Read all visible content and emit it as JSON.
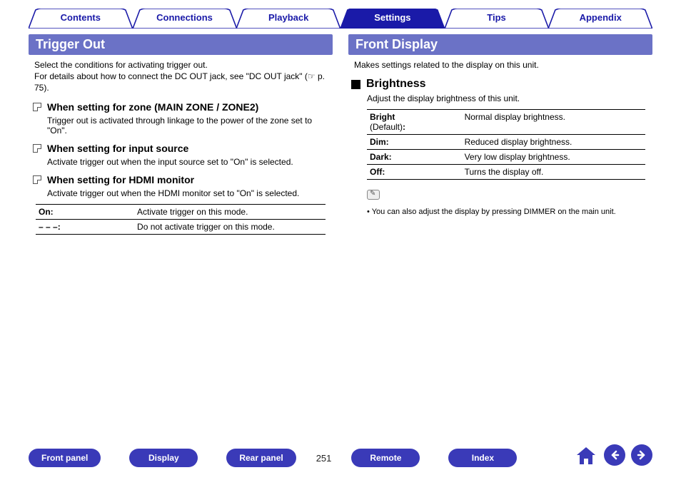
{
  "tabs": {
    "contents": "Contents",
    "connections": "Connections",
    "playback": "Playback",
    "settings": "Settings",
    "tips": "Tips",
    "appendix": "Appendix"
  },
  "left": {
    "header": "Trigger Out",
    "intro1": "Select the conditions for activating trigger out.",
    "intro2": "For details about how to connect the DC OUT jack, see \"DC OUT jack\" (☞ p. 75).",
    "s1_title": "When setting for zone (MAIN ZONE / ZONE2)",
    "s1_desc": "Trigger out is activated through linkage to the power of the zone set to \"On\".",
    "s2_title": "When setting for input source",
    "s2_desc": "Activate trigger out when the input source set to \"On\" is selected.",
    "s3_title": "When setting for HDMI monitor",
    "s3_desc": "Activate trigger out when the HDMI monitor set to \"On\" is selected.",
    "tbl": {
      "r1k": "On:",
      "r1v": "Activate trigger on this mode.",
      "r2k": "– – –:",
      "r2v": "Do not activate trigger on this mode."
    }
  },
  "right": {
    "header": "Front Display",
    "intro": "Makes settings related to the display on this unit.",
    "sub_title": "Brightness",
    "sub_desc": "Adjust the display brightness of this unit.",
    "tbl": {
      "r1k1": "Bright",
      "r1k2": "(Default)",
      "r1kc": ":",
      "r1v": "Normal display brightness.",
      "r2k": "Dim:",
      "r2v": "Reduced display brightness.",
      "r3k": "Dark:",
      "r3v": "Very low display brightness.",
      "r4k": "Off:",
      "r4v": "Turns the display off."
    },
    "note": "You can also adjust the display by pressing DIMMER on the main unit.",
    "note_bullet": "•"
  },
  "bottom": {
    "front_panel": "Front panel",
    "display": "Display",
    "rear_panel": "Rear panel",
    "page": "251",
    "remote": "Remote",
    "index": "Index"
  }
}
